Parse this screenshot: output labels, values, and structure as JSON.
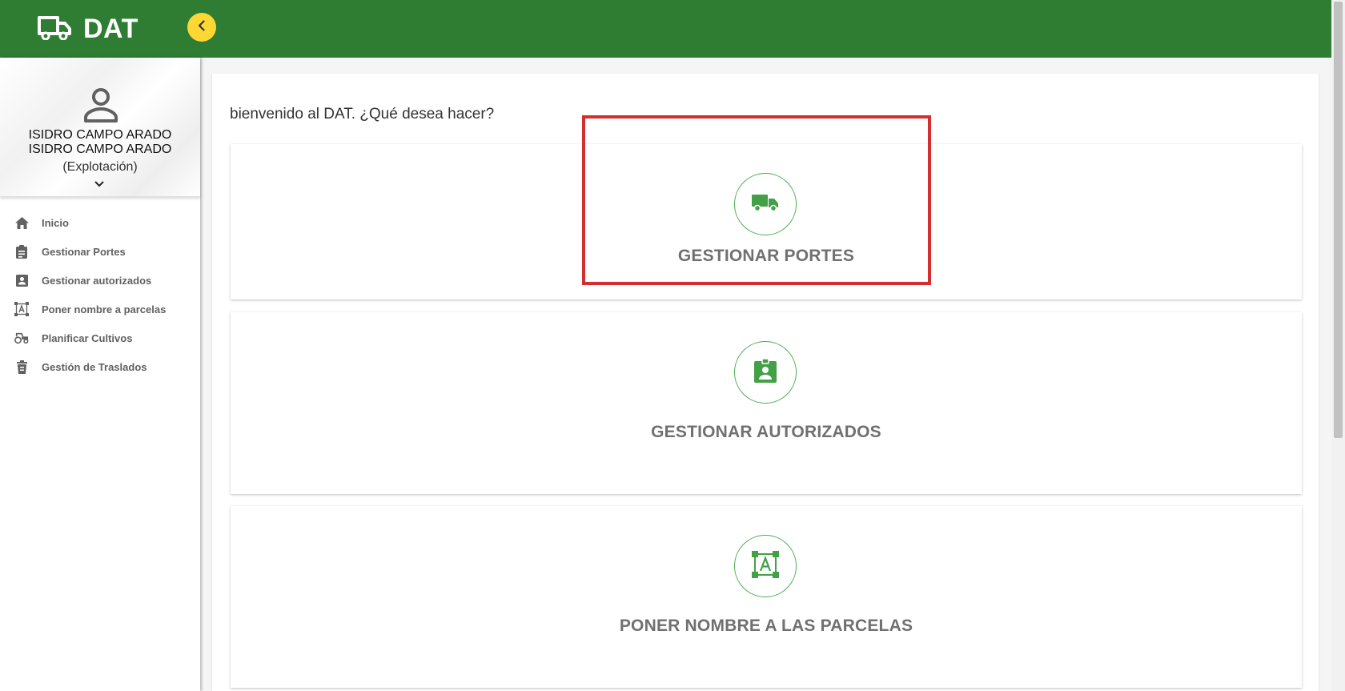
{
  "app": {
    "brand": "DAT",
    "accent_color": "#2e7d32",
    "collapse_button_color": "#fdd835"
  },
  "profile": {
    "name_line1": "ISIDRO CAMPO ARADO",
    "name_line2": "ISIDRO CAMPO ARADO",
    "role": "(Explotación)",
    "avatar_icon": "person-icon"
  },
  "sidebar": {
    "items": [
      {
        "label": "Inicio",
        "icon": "home-icon"
      },
      {
        "label": "Gestionar Portes",
        "icon": "clipboard-icon"
      },
      {
        "label": "Gestionar autorizados",
        "icon": "contact-card-icon"
      },
      {
        "label": "Poner nombre a parcelas",
        "icon": "text-box-icon"
      },
      {
        "label": "Planificar Cultivos",
        "icon": "tractor-icon"
      },
      {
        "label": "Gestión de Traslados",
        "icon": "bin-icon"
      }
    ]
  },
  "main": {
    "welcome": "bienvenido al DAT. ¿Qué desea hacer?",
    "actions": [
      {
        "title": "GESTIONAR PORTES",
        "icon": "truck-icon"
      },
      {
        "title": "GESTIONAR AUTORIZADOS",
        "icon": "badge-icon"
      },
      {
        "title": "PONER NOMBRE A LAS PARCELAS",
        "icon": "text-box-icon"
      }
    ]
  }
}
